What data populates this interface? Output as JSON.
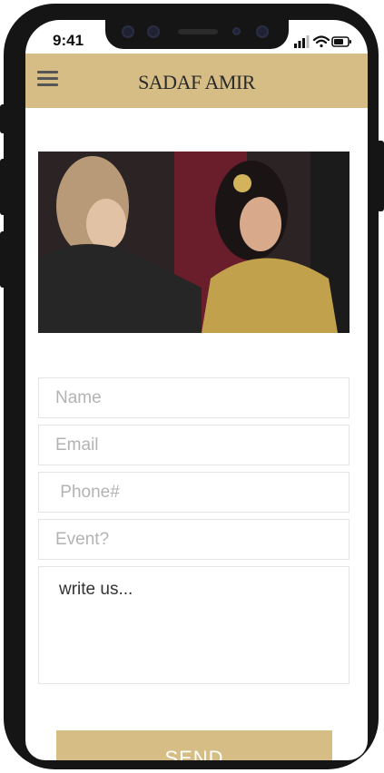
{
  "status": {
    "time": "9:41"
  },
  "header": {
    "title": "SADAF AMIR"
  },
  "form": {
    "name_placeholder": "Name",
    "email_placeholder": "Email",
    "phone_placeholder": " Phone#",
    "event_placeholder": "Event?",
    "message_placeholder": "write us...",
    "send_label": "SEND"
  },
  "colors": {
    "accent": "#d6bd86",
    "frame": "#151515"
  },
  "icons": {
    "menu": "hamburger-menu-icon",
    "signal": "signal-icon",
    "wifi": "wifi-icon",
    "battery": "battery-icon"
  }
}
